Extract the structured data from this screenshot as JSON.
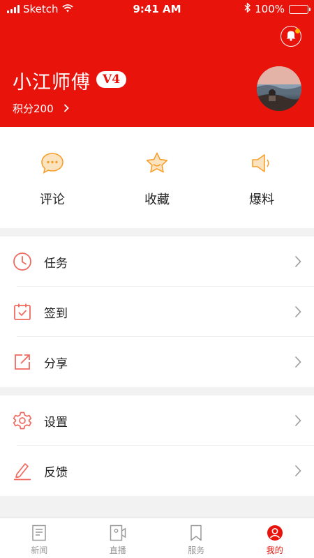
{
  "status_bar": {
    "carrier": "Sketch",
    "time": "9:41 AM",
    "battery_percent": "100%"
  },
  "profile": {
    "name": "小江师傅",
    "level": "V4",
    "points_text": "积分200"
  },
  "quick_actions": [
    {
      "label": "评论",
      "icon": "comment-icon"
    },
    {
      "label": "收藏",
      "icon": "star-icon"
    },
    {
      "label": "爆料",
      "icon": "megaphone-icon"
    }
  ],
  "menu_group_1": [
    {
      "label": "任务",
      "icon": "clock-icon"
    },
    {
      "label": "签到",
      "icon": "calendar-check-icon"
    },
    {
      "label": "分享",
      "icon": "share-icon"
    }
  ],
  "menu_group_2": [
    {
      "label": "设置",
      "icon": "gear-icon"
    },
    {
      "label": "反馈",
      "icon": "pencil-icon"
    }
  ],
  "tabbar": [
    {
      "label": "新闻",
      "icon": "news-icon",
      "active": false
    },
    {
      "label": "直播",
      "icon": "video-icon",
      "active": false
    },
    {
      "label": "服务",
      "icon": "bookmark-icon",
      "active": false
    },
    {
      "label": "我的",
      "icon": "user-icon",
      "active": true
    }
  ],
  "colors": {
    "brand_red": "#e8140c",
    "accent_orange": "#f6a02c",
    "icon_red": "#f06a5f",
    "badge_yellow": "#ffb400"
  }
}
